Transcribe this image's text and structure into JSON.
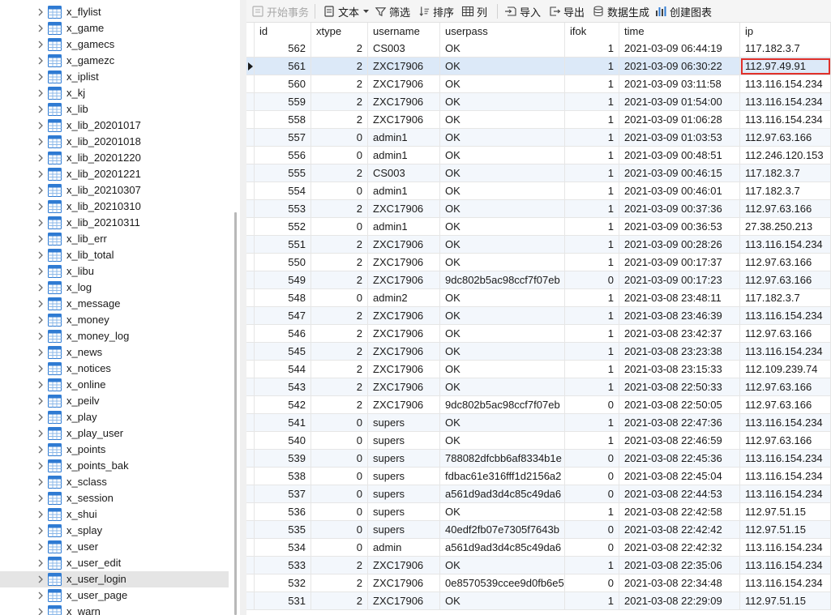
{
  "tree": {
    "items": [
      {
        "label": "x_flylist"
      },
      {
        "label": "x_game"
      },
      {
        "label": "x_gamecs"
      },
      {
        "label": "x_gamezc"
      },
      {
        "label": "x_iplist"
      },
      {
        "label": "x_kj"
      },
      {
        "label": "x_lib"
      },
      {
        "label": "x_lib_20201017"
      },
      {
        "label": "x_lib_20201018"
      },
      {
        "label": "x_lib_20201220"
      },
      {
        "label": "x_lib_20201221"
      },
      {
        "label": "x_lib_20210307"
      },
      {
        "label": "x_lib_20210310"
      },
      {
        "label": "x_lib_20210311"
      },
      {
        "label": "x_lib_err"
      },
      {
        "label": "x_lib_total"
      },
      {
        "label": "x_libu"
      },
      {
        "label": "x_log"
      },
      {
        "label": "x_message"
      },
      {
        "label": "x_money"
      },
      {
        "label": "x_money_log"
      },
      {
        "label": "x_news"
      },
      {
        "label": "x_notices"
      },
      {
        "label": "x_online"
      },
      {
        "label": "x_peilv"
      },
      {
        "label": "x_play"
      },
      {
        "label": "x_play_user"
      },
      {
        "label": "x_points"
      },
      {
        "label": "x_points_bak"
      },
      {
        "label": "x_sclass"
      },
      {
        "label": "x_session"
      },
      {
        "label": "x_shui"
      },
      {
        "label": "x_splay"
      },
      {
        "label": "x_user"
      },
      {
        "label": "x_user_edit"
      },
      {
        "label": "x_user_login",
        "selected": true
      },
      {
        "label": "x_user_page"
      },
      {
        "label": "x_warn"
      }
    ]
  },
  "toolbar": {
    "begin_transaction": "开始事务",
    "text": "文本",
    "filter": "筛选",
    "sort": "排序",
    "columns": "列",
    "import": "导入",
    "export": "导出",
    "data_generation": "数据生成",
    "create_chart": "创建图表"
  },
  "grid": {
    "columns": [
      "id",
      "xtype",
      "username",
      "userpass",
      "ifok",
      "time",
      "ip"
    ],
    "rows": [
      [
        "562",
        "2",
        "CS003",
        "OK",
        "1",
        "2021-03-09 06:44:19",
        "117.182.3.7"
      ],
      [
        "561",
        "2",
        "ZXC17906",
        "OK",
        "1",
        "2021-03-09 06:30:22",
        "112.97.49.91"
      ],
      [
        "560",
        "2",
        "ZXC17906",
        "OK",
        "1",
        "2021-03-09 03:11:58",
        "113.116.154.234"
      ],
      [
        "559",
        "2",
        "ZXC17906",
        "OK",
        "1",
        "2021-03-09 01:54:00",
        "113.116.154.234"
      ],
      [
        "558",
        "2",
        "ZXC17906",
        "OK",
        "1",
        "2021-03-09 01:06:28",
        "113.116.154.234"
      ],
      [
        "557",
        "0",
        "admin1",
        "OK",
        "1",
        "2021-03-09 01:03:53",
        "112.97.63.166"
      ],
      [
        "556",
        "0",
        "admin1",
        "OK",
        "1",
        "2021-03-09 00:48:51",
        "112.246.120.153"
      ],
      [
        "555",
        "2",
        "CS003",
        "OK",
        "1",
        "2021-03-09 00:46:15",
        "117.182.3.7"
      ],
      [
        "554",
        "0",
        "admin1",
        "OK",
        "1",
        "2021-03-09 00:46:01",
        "117.182.3.7"
      ],
      [
        "553",
        "2",
        "ZXC17906",
        "OK",
        "1",
        "2021-03-09 00:37:36",
        "112.97.63.166"
      ],
      [
        "552",
        "0",
        "admin1",
        "OK",
        "1",
        "2021-03-09 00:36:53",
        "27.38.250.213"
      ],
      [
        "551",
        "2",
        "ZXC17906",
        "OK",
        "1",
        "2021-03-09 00:28:26",
        "113.116.154.234"
      ],
      [
        "550",
        "2",
        "ZXC17906",
        "OK",
        "1",
        "2021-03-09 00:17:37",
        "112.97.63.166"
      ],
      [
        "549",
        "2",
        "ZXC17906",
        "9dc802b5ac98ccf7f07eb",
        "0",
        "2021-03-09 00:17:23",
        "112.97.63.166"
      ],
      [
        "548",
        "0",
        "admin2",
        "OK",
        "1",
        "2021-03-08 23:48:11",
        "117.182.3.7"
      ],
      [
        "547",
        "2",
        "ZXC17906",
        "OK",
        "1",
        "2021-03-08 23:46:39",
        "113.116.154.234"
      ],
      [
        "546",
        "2",
        "ZXC17906",
        "OK",
        "1",
        "2021-03-08 23:42:37",
        "112.97.63.166"
      ],
      [
        "545",
        "2",
        "ZXC17906",
        "OK",
        "1",
        "2021-03-08 23:23:38",
        "113.116.154.234"
      ],
      [
        "544",
        "2",
        "ZXC17906",
        "OK",
        "1",
        "2021-03-08 23:15:33",
        "112.109.239.74"
      ],
      [
        "543",
        "2",
        "ZXC17906",
        "OK",
        "1",
        "2021-03-08 22:50:33",
        "112.97.63.166"
      ],
      [
        "542",
        "2",
        "ZXC17906",
        "9dc802b5ac98ccf7f07eb",
        "0",
        "2021-03-08 22:50:05",
        "112.97.63.166"
      ],
      [
        "541",
        "0",
        "supers",
        "OK",
        "1",
        "2021-03-08 22:47:36",
        "113.116.154.234"
      ],
      [
        "540",
        "0",
        "supers",
        "OK",
        "1",
        "2021-03-08 22:46:59",
        "112.97.63.166"
      ],
      [
        "539",
        "0",
        "supers",
        "788082dfcbb6af8334b1e",
        "0",
        "2021-03-08 22:45:36",
        "113.116.154.234"
      ],
      [
        "538",
        "0",
        "supers",
        "fdbac61e316fff1d2156a2",
        "0",
        "2021-03-08 22:45:04",
        "113.116.154.234"
      ],
      [
        "537",
        "0",
        "supers",
        "a561d9ad3d4c85c49da6",
        "0",
        "2021-03-08 22:44:53",
        "113.116.154.234"
      ],
      [
        "536",
        "0",
        "supers",
        "OK",
        "1",
        "2021-03-08 22:42:58",
        "112.97.51.15"
      ],
      [
        "535",
        "0",
        "supers",
        "40edf2fb07e7305f7643b",
        "0",
        "2021-03-08 22:42:42",
        "112.97.51.15"
      ],
      [
        "534",
        "0",
        "admin",
        "a561d9ad3d4c85c49da6",
        "0",
        "2021-03-08 22:42:32",
        "113.116.154.234"
      ],
      [
        "533",
        "2",
        "ZXC17906",
        "OK",
        "1",
        "2021-03-08 22:35:06",
        "113.116.154.234"
      ],
      [
        "532",
        "2",
        "ZXC17906",
        "0e8570539ccee9d0fb6e5",
        "0",
        "2021-03-08 22:34:48",
        "113.116.154.234"
      ],
      [
        "531",
        "2",
        "ZXC17906",
        "OK",
        "1",
        "2021-03-08 22:29:09",
        "112.97.51.15"
      ]
    ],
    "selected_row_id": "561",
    "highlighted_cell": "112.97.49.91"
  },
  "colors": {
    "accent": "#e0302a",
    "selected_row": "#dce9f8",
    "alt_row": "#f3f7fc",
    "table_icon": "#2f7bd3"
  }
}
